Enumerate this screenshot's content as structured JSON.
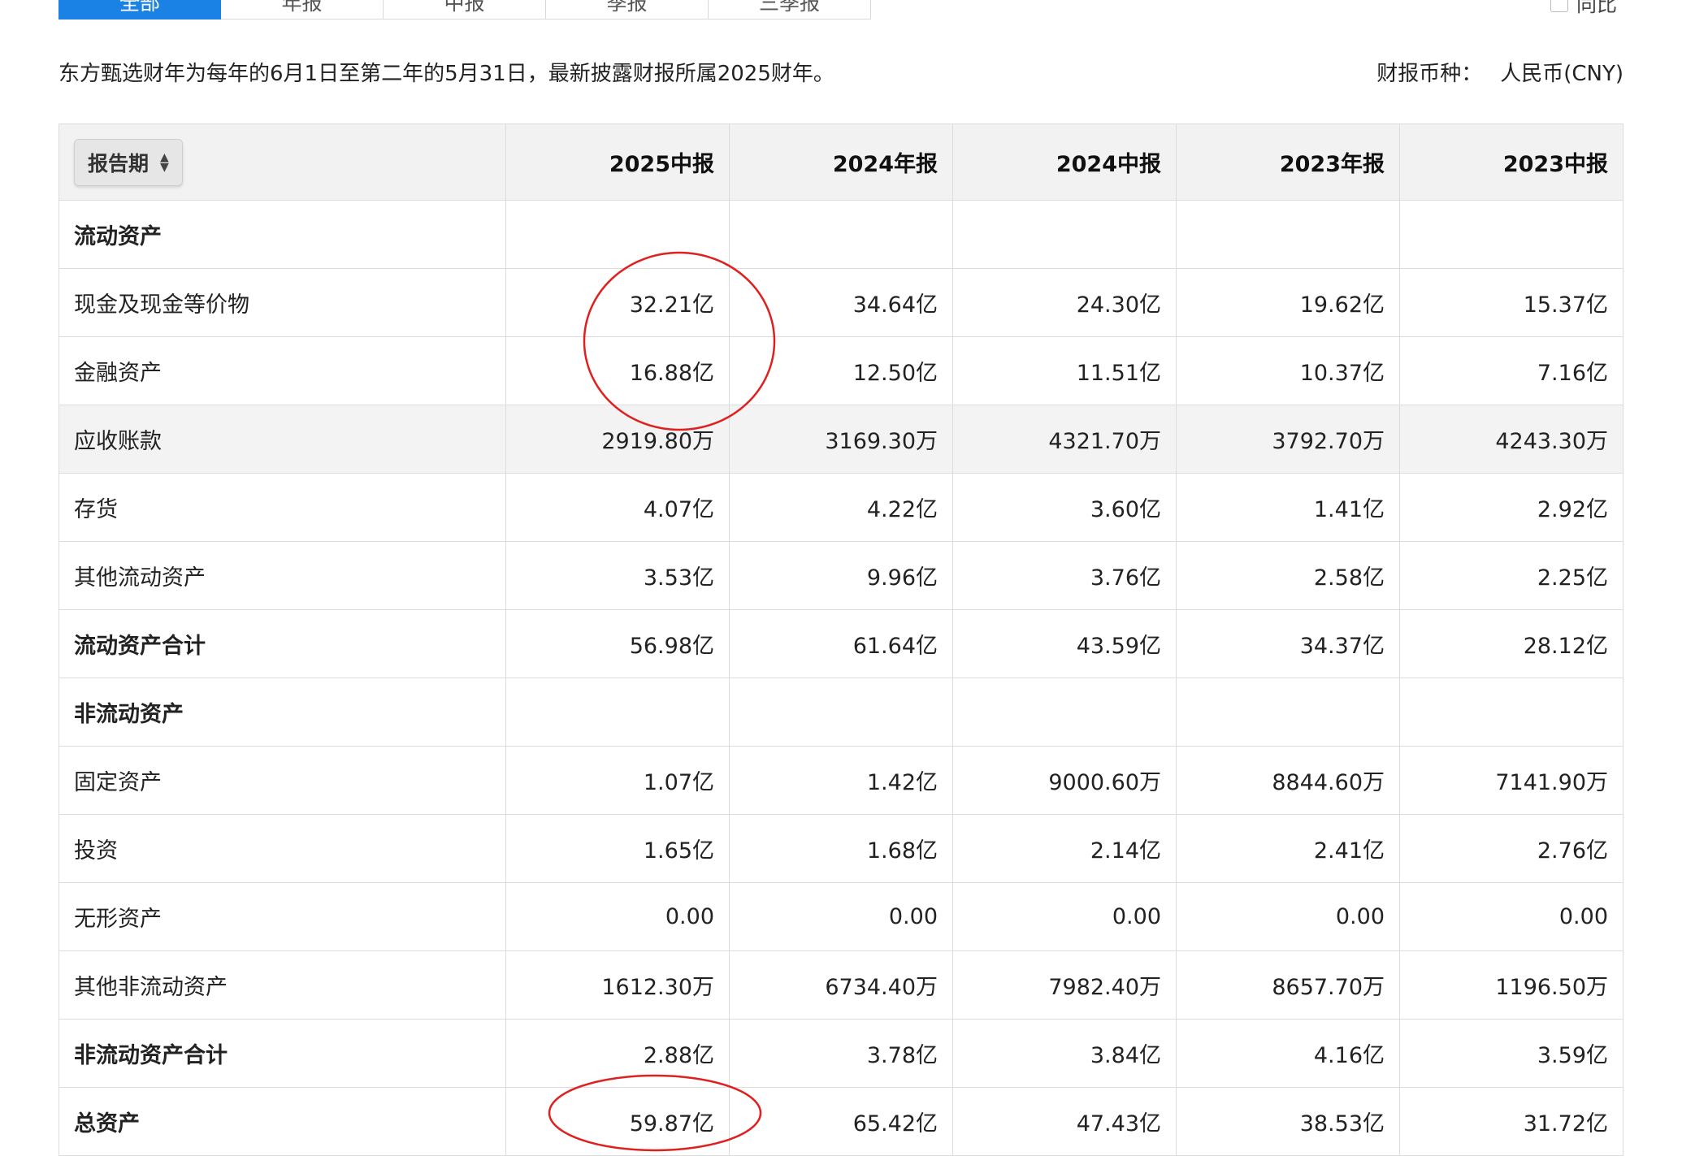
{
  "tabs": [
    "全部",
    "年报",
    "中报",
    "季报",
    "三季报"
  ],
  "compare_label": "同比",
  "info_text": "东方甄选财年为每年的6月1日至第二年的5月31日，最新披露财报所属2025财年。",
  "currency_label": "财报币种：",
  "currency_value": "人民币(CNY)",
  "table": {
    "period_button": "报告期",
    "columns": [
      "2025中报",
      "2024年报",
      "2024中报",
      "2023年报",
      "2023中报"
    ],
    "rows": [
      {
        "label": "流动资产",
        "bold": true,
        "shade": false,
        "values": [
          "",
          "",
          "",
          "",
          ""
        ]
      },
      {
        "label": "现金及现金等价物",
        "bold": false,
        "shade": false,
        "values": [
          "32.21亿",
          "34.64亿",
          "24.30亿",
          "19.62亿",
          "15.37亿"
        ]
      },
      {
        "label": "金融资产",
        "bold": false,
        "shade": false,
        "values": [
          "16.88亿",
          "12.50亿",
          "11.51亿",
          "10.37亿",
          "7.16亿"
        ]
      },
      {
        "label": "应收账款",
        "bold": false,
        "shade": true,
        "values": [
          "2919.80万",
          "3169.30万",
          "4321.70万",
          "3792.70万",
          "4243.30万"
        ]
      },
      {
        "label": "存货",
        "bold": false,
        "shade": false,
        "values": [
          "4.07亿",
          "4.22亿",
          "3.60亿",
          "1.41亿",
          "2.92亿"
        ]
      },
      {
        "label": "其他流动资产",
        "bold": false,
        "shade": false,
        "values": [
          "3.53亿",
          "9.96亿",
          "3.76亿",
          "2.58亿",
          "2.25亿"
        ]
      },
      {
        "label": "流动资产合计",
        "bold": true,
        "shade": false,
        "values": [
          "56.98亿",
          "61.64亿",
          "43.59亿",
          "34.37亿",
          "28.12亿"
        ]
      },
      {
        "label": "非流动资产",
        "bold": true,
        "shade": false,
        "values": [
          "",
          "",
          "",
          "",
          ""
        ]
      },
      {
        "label": "固定资产",
        "bold": false,
        "shade": false,
        "values": [
          "1.07亿",
          "1.42亿",
          "9000.60万",
          "8844.60万",
          "7141.90万"
        ]
      },
      {
        "label": "投资",
        "bold": false,
        "shade": false,
        "values": [
          "1.65亿",
          "1.68亿",
          "2.14亿",
          "2.41亿",
          "2.76亿"
        ]
      },
      {
        "label": "无形资产",
        "bold": false,
        "shade": false,
        "values": [
          "0.00",
          "0.00",
          "0.00",
          "0.00",
          "0.00"
        ]
      },
      {
        "label": "其他非流动资产",
        "bold": false,
        "shade": false,
        "values": [
          "1612.30万",
          "6734.40万",
          "7982.40万",
          "8657.70万",
          "1196.50万"
        ]
      },
      {
        "label": "非流动资产合计",
        "bold": true,
        "shade": false,
        "values": [
          "2.88亿",
          "3.78亿",
          "3.84亿",
          "4.16亿",
          "3.59亿"
        ]
      },
      {
        "label": "总资产",
        "bold": true,
        "shade": false,
        "values": [
          "59.87亿",
          "65.42亿",
          "47.43亿",
          "38.53亿",
          "31.72亿"
        ]
      }
    ]
  },
  "annotation_color": "#e0201e"
}
